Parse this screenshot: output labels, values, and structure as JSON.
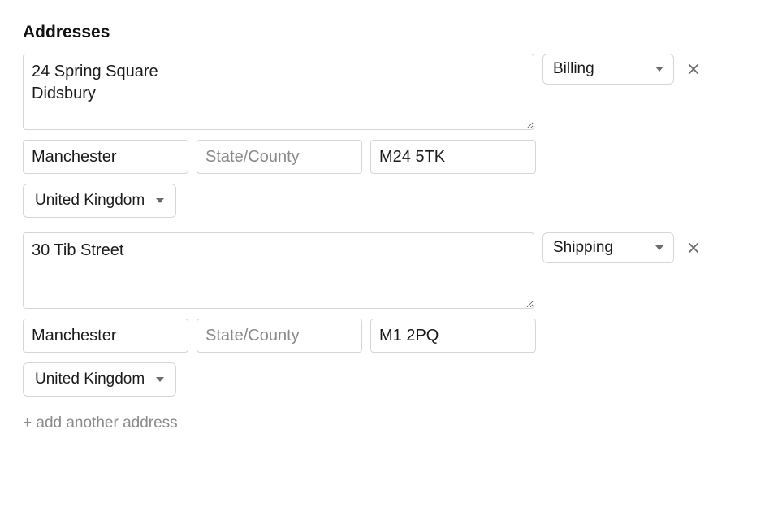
{
  "section_title": "Addresses",
  "placeholders": {
    "state": "State/County"
  },
  "addresses": [
    {
      "street": "24 Spring Square\nDidsbury",
      "city": "Manchester",
      "state": "",
      "postal": "M24 5TK",
      "country": "United Kingdom",
      "type": "Billing"
    },
    {
      "street": "30 Tib Street",
      "city": "Manchester",
      "state": "",
      "postal": "M1 2PQ",
      "country": "United Kingdom",
      "type": "Shipping"
    }
  ],
  "add_link": "+ add another address"
}
